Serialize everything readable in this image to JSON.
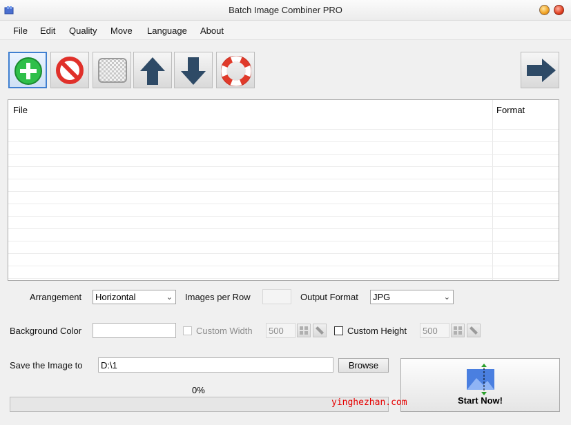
{
  "window": {
    "title": "Batch Image Combiner PRO"
  },
  "menu": [
    "File",
    "Edit",
    "Quality",
    "Move",
    "Language",
    "About"
  ],
  "toolbar": {
    "buttons": [
      {
        "icon": "add-icon"
      },
      {
        "icon": "remove-icon"
      },
      {
        "icon": "clear-icon"
      },
      {
        "icon": "move-up-icon"
      },
      {
        "icon": "move-down-icon"
      },
      {
        "icon": "help-icon"
      }
    ],
    "next_icon": "next-arrow-icon"
  },
  "file_list": {
    "columns": [
      "File",
      "Format"
    ],
    "rows": []
  },
  "options": {
    "arrangement_label": "Arrangement",
    "arrangement_value": "Horizontal",
    "images_per_row_label": "Images per Row",
    "images_per_row_value": "",
    "output_format_label": "Output Format",
    "output_format_value": "JPG",
    "background_color_label": "Background Color",
    "custom_width_label": "Custom Width",
    "custom_width_value": "500",
    "custom_height_label": "Custom Height",
    "custom_height_value": "500"
  },
  "save": {
    "label": "Save the Image to",
    "path": "D:\\1",
    "browse_label": "Browse"
  },
  "start": {
    "label": "Start Now!"
  },
  "progress": {
    "text": "0%",
    "value": 0
  },
  "watermark": "yinghezhan.com"
}
